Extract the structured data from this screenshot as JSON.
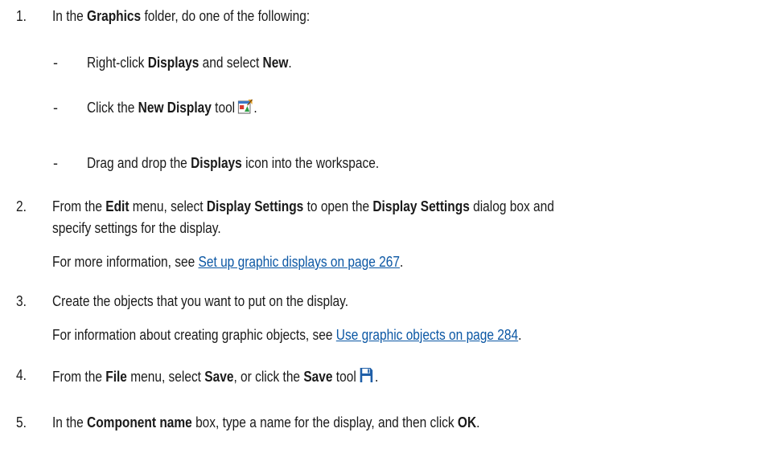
{
  "steps": [
    {
      "num": "1.",
      "parts": [
        "In the ",
        "Graphics",
        " folder, do one of the following:"
      ],
      "options": [
        {
          "parts": [
            "Right-click ",
            "Displays",
            " and select ",
            "New",
            "."
          ]
        },
        {
          "parts": [
            "Click the ",
            "New Display",
            " tool",
            "."
          ],
          "icon": "new-display-icon"
        },
        {
          "parts": [
            "Drag and drop the ",
            "Displays",
            " icon into the workspace."
          ]
        }
      ]
    },
    {
      "num": "2.",
      "parts": [
        "From the ",
        "Edit",
        " menu, select ",
        "Display Settings",
        " to open the ",
        "Display Settings",
        " dialog box and"
      ],
      "line2": "specify settings for the display.",
      "note": {
        "text": "For more information, see ",
        "link": "Set up graphic displays on page 267",
        "end": "."
      }
    },
    {
      "num": "3.",
      "text": "Create the objects that you want to put on the display.",
      "note": {
        "text": "For information about creating graphic objects, see ",
        "link": "Use graphic objects on page 284",
        "end": "."
      }
    },
    {
      "num": "4.",
      "parts": [
        "From the ",
        "File",
        " menu, select ",
        "Save",
        ", or click the ",
        "Save",
        " tool",
        "."
      ],
      "icon": "save-icon"
    },
    {
      "num": "5.",
      "parts": [
        "In the ",
        "Component name",
        " box, type a name for the display, and then click ",
        "OK",
        "."
      ]
    }
  ],
  "colors": {
    "text": "#1a1a1a",
    "link": "#0b57a4",
    "save_icon": "#1f5fa8"
  },
  "option_marker": "-"
}
